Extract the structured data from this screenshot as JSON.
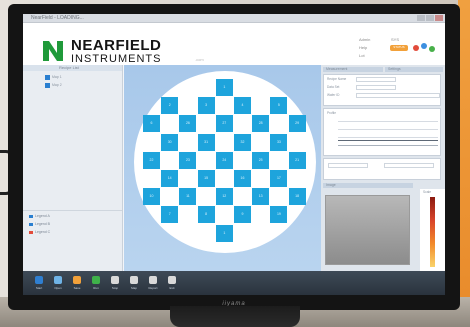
{
  "app": {
    "title": "NearField - LOADING..."
  },
  "brand": {
    "name_top": "NEARFIELD",
    "name_bottom": "INSTRUMENTS",
    "tagline": ".com",
    "monitor_brand": "iiyama"
  },
  "header_right": {
    "items": [
      "Admin",
      "Help",
      "Lot",
      "SYS"
    ],
    "status_pill": "STATUS"
  },
  "left_panel": {
    "title": "Recipe List",
    "items": [
      "Map 1",
      "Map 2"
    ],
    "legend": [
      "Legend A",
      "Legend B",
      "Legend C"
    ]
  },
  "wafer": {
    "dies": [
      {
        "row": 0,
        "col": 4,
        "label": "1"
      },
      {
        "row": 1,
        "col": 1,
        "label": "2"
      },
      {
        "row": 1,
        "col": 3,
        "label": "3"
      },
      {
        "row": 1,
        "col": 5,
        "label": "4"
      },
      {
        "row": 1,
        "col": 7,
        "label": "5"
      },
      {
        "row": 2,
        "col": 0,
        "label": "6"
      },
      {
        "row": 2,
        "col": 2,
        "label": "26"
      },
      {
        "row": 2,
        "col": 4,
        "label": "27"
      },
      {
        "row": 2,
        "col": 6,
        "label": "28"
      },
      {
        "row": 2,
        "col": 8,
        "label": "29"
      },
      {
        "row": 3,
        "col": 1,
        "label": "30"
      },
      {
        "row": 3,
        "col": 3,
        "label": "31"
      },
      {
        "row": 3,
        "col": 5,
        "label": "32"
      },
      {
        "row": 3,
        "col": 7,
        "label": "33"
      },
      {
        "row": 4,
        "col": 0,
        "label": "22"
      },
      {
        "row": 4,
        "col": 2,
        "label": "23"
      },
      {
        "row": 4,
        "col": 4,
        "label": "24"
      },
      {
        "row": 4,
        "col": 6,
        "label": "25"
      },
      {
        "row": 4,
        "col": 8,
        "label": "21"
      },
      {
        "row": 5,
        "col": 1,
        "label": "14"
      },
      {
        "row": 5,
        "col": 3,
        "label": "15"
      },
      {
        "row": 5,
        "col": 5,
        "label": "16"
      },
      {
        "row": 5,
        "col": 7,
        "label": "17"
      },
      {
        "row": 6,
        "col": 0,
        "label": "10"
      },
      {
        "row": 6,
        "col": 2,
        "label": "11"
      },
      {
        "row": 6,
        "col": 4,
        "label": "12"
      },
      {
        "row": 6,
        "col": 6,
        "label": "13"
      },
      {
        "row": 6,
        "col": 8,
        "label": "18"
      },
      {
        "row": 7,
        "col": 1,
        "label": "7"
      },
      {
        "row": 7,
        "col": 3,
        "label": "8"
      },
      {
        "row": 7,
        "col": 5,
        "label": "9"
      },
      {
        "row": 7,
        "col": 7,
        "label": "19"
      },
      {
        "row": 8,
        "col": 4,
        "label": "1"
      }
    ]
  },
  "right_panel": {
    "section_titles": [
      "Measurement",
      "Settings",
      "Image",
      "Scale"
    ],
    "rows": [
      "Recipe Name",
      "Data Set",
      "Wafer ID"
    ],
    "plot_label": "Profile"
  },
  "taskbar": {
    "items": [
      {
        "label": "Start",
        "color": "#2f7fd1"
      },
      {
        "label": "Open",
        "color": "#6fb3e6"
      },
      {
        "label": "Save",
        "color": "#f2a13a"
      },
      {
        "label": "Run",
        "color": "#3fb24a"
      },
      {
        "label": "Stop",
        "color": "#d9d9d9"
      },
      {
        "label": "Map",
        "color": "#d9d9d9"
      },
      {
        "label": "Report",
        "color": "#d9d9d9"
      },
      {
        "label": "Exit",
        "color": "#d9d9d9"
      }
    ]
  },
  "colors": {
    "die": "#1ea4dc",
    "wafer_bg": "#ffffff",
    "accent": "#2a7fd0",
    "logo_green": "#1f9a3a"
  }
}
